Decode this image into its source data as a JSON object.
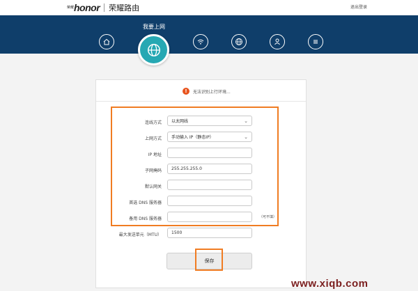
{
  "header": {
    "brand_small": "荣耀",
    "brand_word": "honor",
    "product_title": "荣耀路由",
    "logout_label": "退出登录"
  },
  "nav": {
    "active_label": "我要上网",
    "items": [
      {
        "icon": "home-icon"
      },
      {
        "icon": "globe-icon"
      },
      {
        "icon": "wifi-icon"
      },
      {
        "icon": "network-globe-icon"
      },
      {
        "icon": "user-icon"
      },
      {
        "icon": "menu-icon"
      }
    ]
  },
  "status": {
    "icon": "!",
    "text": "无法识别上行环境..."
  },
  "form": {
    "connection_type_label": "连线方式",
    "connection_type_value": "以太网线",
    "internet_mode_label": "上网方式",
    "internet_mode_value": "手动输入 IP（静态IP）",
    "ip_label": "IP 地址",
    "ip_value": "",
    "subnet_label": "子网掩码",
    "subnet_value": "255.255.255.0",
    "gateway_label": "默认网关",
    "gateway_value": "",
    "dns1_label": "首选 DNS 服务器",
    "dns1_value": "",
    "dns2_label": "备用 DNS 服务器",
    "dns2_value": "",
    "dns2_optional": "（可不填）",
    "mtu_label": "最大发送单元（MTU）",
    "mtu_value": "1500",
    "save_label": "保存"
  },
  "watermark": "www.xiqb.com",
  "colors": {
    "nav_background": "#0f3e6a",
    "active_nav": "#26a8b3",
    "highlight": "#f07c22",
    "warning": "#e8541e"
  }
}
